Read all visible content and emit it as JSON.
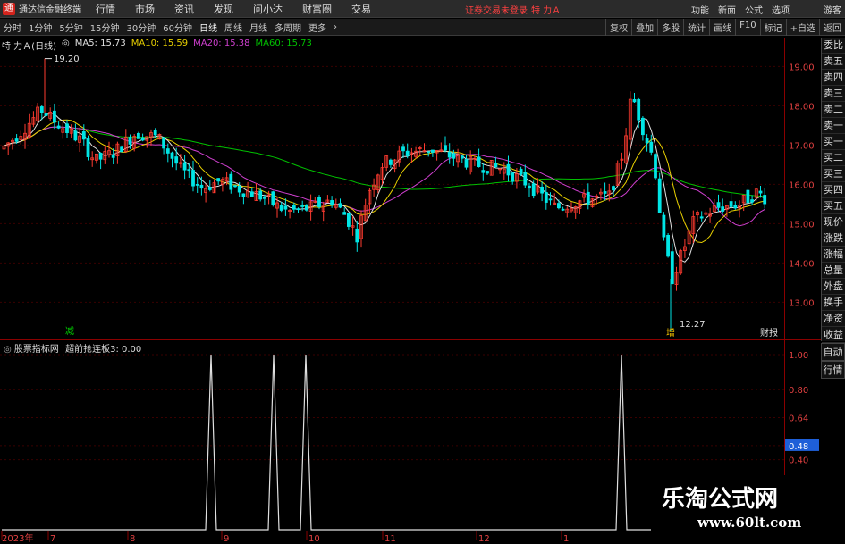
{
  "menubar": {
    "app_title": "通达信金融终端",
    "items": [
      "行情",
      "市场",
      "资讯",
      "发现",
      "问小达",
      "财富圈",
      "交易"
    ],
    "status": "证券交易未登录",
    "stock_header": "特 力Ａ",
    "right_items": [
      "功能",
      "新面",
      "公式",
      "选项",
      "游客"
    ]
  },
  "toolbar": {
    "periods": [
      "分时",
      "1分钟",
      "5分钟",
      "15分钟",
      "30分钟",
      "60分钟",
      "日线",
      "周线",
      "月线",
      "多周期",
      "更多"
    ],
    "active_period": "日线",
    "right_buttons": [
      "复权",
      "叠加",
      "多股",
      "统计",
      "画线",
      "F10",
      "标记",
      "+自选",
      "返回"
    ]
  },
  "ma_row": {
    "stock": "特 力Ａ(日线)",
    "ma5": "MA5: 15.73",
    "ma10": "MA10: 15.59",
    "ma20": "MA20: 15.38",
    "ma60": "MA60: 15.73"
  },
  "colors": {
    "up": "#ff3b30",
    "down": "#00e5e5",
    "ma5": "#e0e0e0",
    "ma10": "#e8d000",
    "ma20": "#d040d0",
    "ma60": "#00c000"
  },
  "price_axis": [
    "19.00",
    "18.00",
    "17.00",
    "16.00",
    "15.00",
    "14.00",
    "13.00"
  ],
  "annotations": {
    "high": "19.20",
    "low": "12.27",
    "event_left": "减",
    "event_mid": "增",
    "event_right": "财报"
  },
  "right_panel": [
    "委比",
    "卖五",
    "卖四",
    "卖三",
    "卖二",
    "卖一",
    "买一",
    "买二",
    "买三",
    "买四",
    "买五",
    "现价",
    "涨跌",
    "涨幅",
    "总量",
    "外盘",
    "换手",
    "净资",
    "收益"
  ],
  "right_panel_lower": [
    "自动",
    "行情"
  ],
  "indicator": {
    "source": "股票指标网",
    "name": "超前抢连板3: 0.00",
    "axis": [
      "1.00",
      "0.80",
      "0.64",
      "0.48",
      "0.40"
    ],
    "highlight": "0.48"
  },
  "date_axis": [
    "2023年",
    "7",
    "8",
    "9",
    "10",
    "11",
    "12",
    "1"
  ],
  "watermark": {
    "cn": "乐淘公式网",
    "url": "www.60lt.com"
  }
}
